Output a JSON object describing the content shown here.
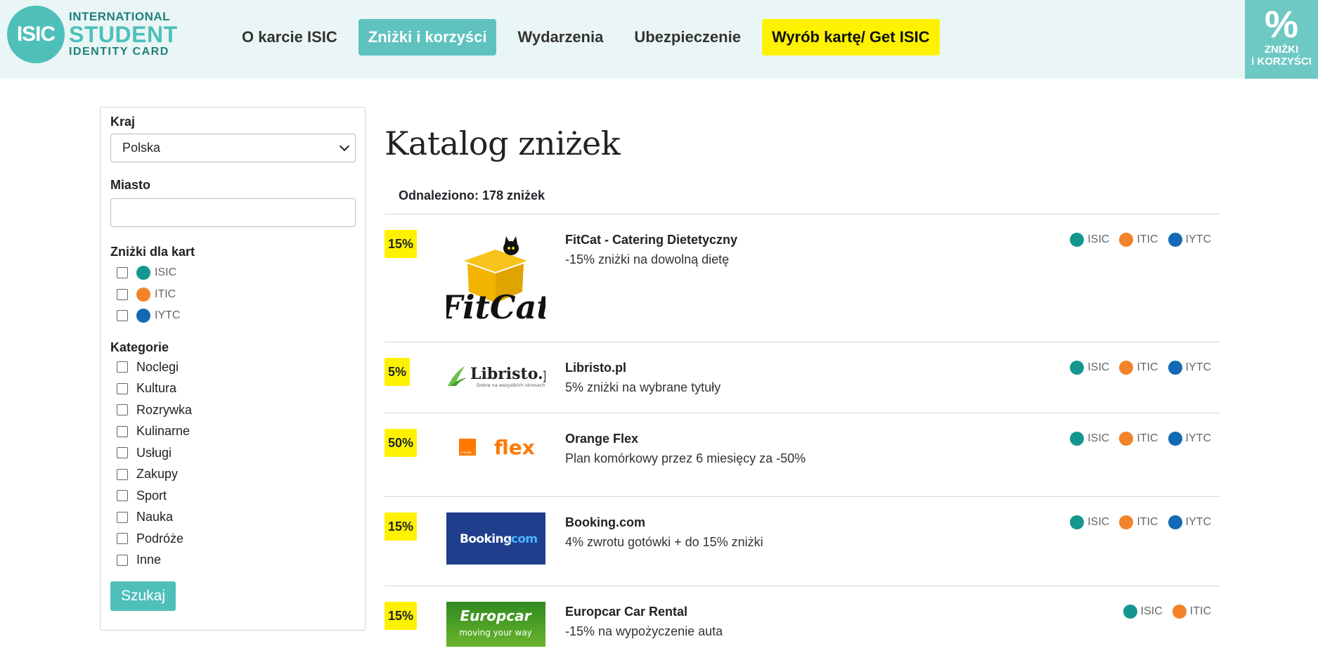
{
  "header": {
    "logo": {
      "mark": "ISIC",
      "line1": "INTERNATIONAL",
      "line2": "STUDENT",
      "line3": "IDENTITY CARD"
    },
    "nav": [
      {
        "label": "O karcie ISIC",
        "state": "default"
      },
      {
        "label": "Zniżki i korzyści",
        "state": "active"
      },
      {
        "label": "Wydarzenia",
        "state": "default"
      },
      {
        "label": "Ubezpieczenie",
        "state": "default"
      },
      {
        "label": "Wyrób kartę/ Get ISIC",
        "state": "cta"
      }
    ],
    "promo": {
      "symbol": "%",
      "line1": "ZNIŻKI",
      "line2": "i KORZYŚCI"
    }
  },
  "filters": {
    "country_label": "Kraj",
    "country_value": "Polska",
    "city_label": "Miasto",
    "city_value": "",
    "cards_label": "Zniżki dla kart",
    "cards": [
      {
        "label": "ISIC",
        "color": "#14968e"
      },
      {
        "label": "ITIC",
        "color": "#f2832a"
      },
      {
        "label": "IYTC",
        "color": "#1369b3"
      }
    ],
    "categories_label": "Kategorie",
    "categories": [
      "Noclegi",
      "Kultura",
      "Rozrywka",
      "Kulinarne",
      "Usługi",
      "Zakupy",
      "Sport",
      "Nauka",
      "Podróże",
      "Inne"
    ],
    "search_button": "Szukaj"
  },
  "main": {
    "title": "Katalog zniżek",
    "found": "Odnaleziono: 178 zniżek",
    "items": [
      {
        "discount": "15%",
        "name": "FitCat - Catering Dietetyczny",
        "description": "-15% zniżki na dowolną dietę",
        "logo": "FitCat",
        "cards": [
          "ISIC",
          "ITIC",
          "IYTC"
        ]
      },
      {
        "discount": "5%",
        "name": "Libristo.pl",
        "description": "5% zniżki na wybrane tytuły",
        "logo": "Libristo.pl",
        "logo_sub": "Dobre na wszystkich stronach",
        "cards": [
          "ISIC",
          "ITIC",
          "IYTC"
        ]
      },
      {
        "discount": "50%",
        "name": "Orange Flex",
        "description": "Plan komórkowy przez 6 miesięcy za -50%",
        "logo": "flex",
        "logo_sub": "orange",
        "cards": [
          "ISIC",
          "ITIC",
          "IYTC"
        ]
      },
      {
        "discount": "15%",
        "name": "Booking.com",
        "description": "4% zwrotu gotówki + do 15% zniżki",
        "logo": "Booking",
        "logo_sub": ".com",
        "cards": [
          "ISIC",
          "ITIC",
          "IYTC"
        ]
      },
      {
        "discount": "15%",
        "name": "Europcar Car Rental",
        "description": "-15% na wypożyczenie auta",
        "logo": "Europcar",
        "logo_sub": "moving your way",
        "cards": [
          "ISIC",
          "ITIC"
        ]
      }
    ]
  },
  "colors": {
    "accent": "#4fbfba",
    "cta": "#fff200",
    "header_bg": "#eaf6f5",
    "isic": "#14968e",
    "itic": "#f2832a",
    "iytc": "#1369b3"
  }
}
